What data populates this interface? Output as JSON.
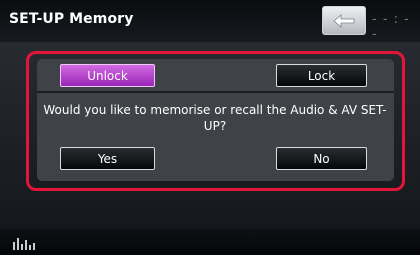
{
  "header": {
    "title": "SET-UP Memory",
    "back_icon": "back-arrow-icon",
    "status_text": "- - : - -"
  },
  "dialog": {
    "unlock_label": "Unlock",
    "lock_label": "Lock",
    "question": "Would you like to memorise or recall the Audio & AV SET-UP?",
    "yes_label": "Yes",
    "no_label": "No",
    "active_button": "Unlock",
    "highlight_color": "#e3163a",
    "active_color": "#b43fcc"
  },
  "footer": {
    "equalizer_icon": "equalizer-icon"
  }
}
